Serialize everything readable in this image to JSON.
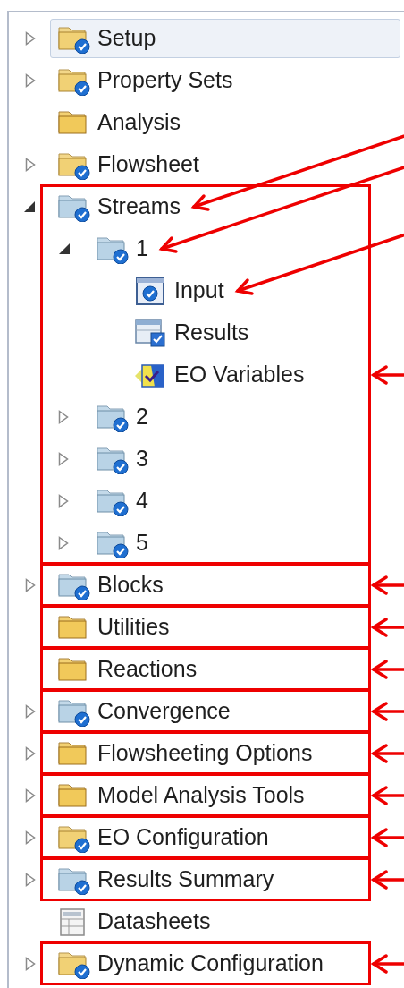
{
  "tree": [
    {
      "label": "Setup",
      "kind": "folder-check",
      "expanded": false,
      "selected": true,
      "boxed": false,
      "pointer": false
    },
    {
      "label": "Property Sets",
      "kind": "folder-check",
      "expanded": false,
      "selected": false,
      "boxed": false,
      "pointer": false
    },
    {
      "label": "Analysis",
      "kind": "folder",
      "selected": false,
      "boxed": false,
      "pointer": false
    },
    {
      "label": "Flowsheet",
      "kind": "folder-check",
      "expanded": false,
      "selected": false,
      "boxed": false,
      "pointer": false
    },
    {
      "label": "Streams",
      "kind": "blue-folder-check",
      "expanded": true,
      "selected": false,
      "boxed": true,
      "pointer": true,
      "children": [
        {
          "label": "1",
          "kind": "blue-folder-check",
          "expanded": true,
          "selected": false,
          "pointer": true,
          "children": [
            {
              "label": "Input",
              "kind": "form",
              "selected": false,
              "pointer": true
            },
            {
              "label": "Results",
              "kind": "results-table",
              "selected": false,
              "pointer": false
            },
            {
              "label": "EO Variables",
              "kind": "eo-variables",
              "selected": false,
              "pointer": false
            }
          ]
        },
        {
          "label": "2",
          "kind": "blue-folder-check",
          "expanded": false,
          "selected": false,
          "pointer": false
        },
        {
          "label": "3",
          "kind": "blue-folder-check",
          "expanded": false,
          "selected": false,
          "pointer": false
        },
        {
          "label": "4",
          "kind": "blue-folder-check",
          "expanded": false,
          "selected": false,
          "pointer": false
        },
        {
          "label": "5",
          "kind": "blue-folder-check",
          "expanded": false,
          "selected": false,
          "pointer": false
        }
      ]
    },
    {
      "label": "Blocks",
      "kind": "blue-folder-check",
      "expanded": false,
      "selected": false,
      "boxed": true,
      "pointer": false
    },
    {
      "label": "Utilities",
      "kind": "folder",
      "selected": false,
      "boxed": true,
      "pointer": false
    },
    {
      "label": "Reactions",
      "kind": "folder",
      "selected": false,
      "boxed": true,
      "pointer": false
    },
    {
      "label": "Convergence",
      "kind": "blue-folder-check",
      "expanded": false,
      "selected": false,
      "boxed": true,
      "pointer": false
    },
    {
      "label": "Flowsheeting Options",
      "kind": "folder",
      "expanded": false,
      "selected": false,
      "boxed": true,
      "pointer": false
    },
    {
      "label": "Model Analysis Tools",
      "kind": "folder",
      "expanded": false,
      "selected": false,
      "boxed": true,
      "pointer": false
    },
    {
      "label": "EO Configuration",
      "kind": "folder-check",
      "expanded": false,
      "selected": false,
      "boxed": true,
      "pointer": false
    },
    {
      "label": "Results Summary",
      "kind": "blue-folder-check",
      "expanded": false,
      "selected": false,
      "boxed": true,
      "pointer": false
    },
    {
      "label": "Datasheets",
      "kind": "datasheet",
      "selected": false,
      "boxed": false,
      "pointer": false
    },
    {
      "label": "Dynamic Configuration",
      "kind": "folder-check",
      "expanded": false,
      "selected": false,
      "boxed": true,
      "pointer": false
    }
  ]
}
